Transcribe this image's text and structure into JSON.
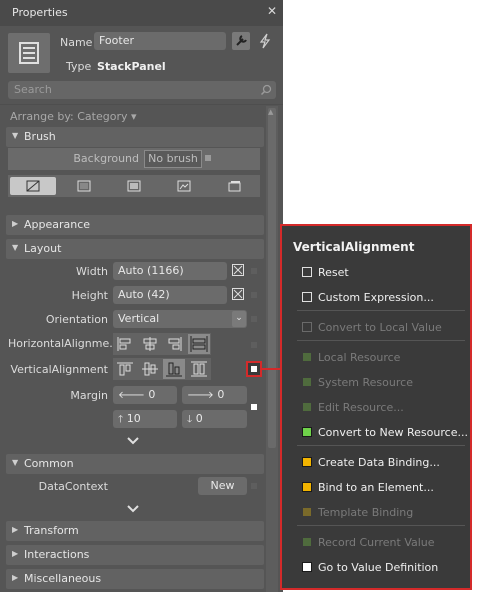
{
  "panel": {
    "title": "Properties",
    "name_label": "Name",
    "name_value": "Footer",
    "type_label": "Type",
    "type_value": "StackPanel",
    "search_placeholder": "Search",
    "arrange_by": "Arrange by: Category ▾"
  },
  "brush": {
    "header": "Brush",
    "background_label": "Background",
    "background_value": "No brush"
  },
  "appearance": {
    "header": "Appearance"
  },
  "layout": {
    "header": "Layout",
    "width_label": "Width",
    "width_value": "Auto (1166)",
    "height_label": "Height",
    "height_value": "Auto (42)",
    "orientation_label": "Orientation",
    "orientation_value": "Vertical",
    "halign_label": "HorizontalAlignme...",
    "valign_label": "VerticalAlignment",
    "margin_label": "Margin",
    "margin_left": "0",
    "margin_right": "0",
    "margin_top": "10",
    "margin_bottom": "0"
  },
  "common": {
    "header": "Common",
    "datacontext_label": "DataContext",
    "new_button": "New"
  },
  "collapsed_sections": {
    "transform": "Transform",
    "interactions": "Interactions",
    "misc": "Miscellaneous"
  },
  "menu": {
    "title": "VerticalAlignment",
    "items": [
      {
        "label": "Reset",
        "box": "#3a3a3a",
        "enabled": true
      },
      {
        "label": "Custom Expression...",
        "box": "#3a3a3a",
        "enabled": true
      },
      {
        "label": "Convert to Local Value",
        "box": "#3a3a3a",
        "enabled": false
      },
      {
        "label": "Local Resource",
        "box": "#4f6b3d",
        "enabled": false
      },
      {
        "label": "System Resource",
        "box": "#4f6b3d",
        "enabled": false
      },
      {
        "label": "Edit Resource...",
        "box": "#4f6b3d",
        "enabled": false
      },
      {
        "label": "Convert to New Resource...",
        "box": "#6fd24a",
        "enabled": true
      },
      {
        "label": "Create Data Binding...",
        "box": "#f2b400",
        "enabled": true
      },
      {
        "label": "Bind to an Element...",
        "box": "#f2b400",
        "enabled": true
      },
      {
        "label": "Template Binding",
        "box": "#7a6a2a",
        "enabled": false
      },
      {
        "label": "Record Current Value",
        "box": "#4f6b3d",
        "enabled": false
      },
      {
        "label": "Go to Value Definition",
        "box": "#ffffff",
        "enabled": true
      }
    ]
  },
  "colors": {
    "menu_border": "#d42a2a",
    "panel_bg": "#555555",
    "menu_bg": "#3a3a3a"
  }
}
